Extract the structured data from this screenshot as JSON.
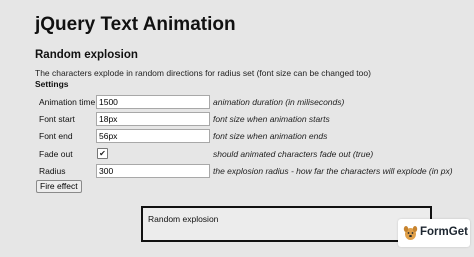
{
  "page": {
    "title": "jQuery Text Animation"
  },
  "section": {
    "title": "Random explosion",
    "description": "The characters explode in random directions for radius set (font size can be changed too)",
    "settings_heading": "Settings"
  },
  "settings": [
    {
      "label": "Animation time",
      "value": "1500",
      "hint": "animation duration (in miliseconds)"
    },
    {
      "label": "Font start",
      "value": "18px",
      "hint": "font size when animation starts"
    },
    {
      "label": "Font end",
      "value": "56px",
      "hint": "font size when animation ends"
    },
    {
      "label": "Fade out",
      "checked": true,
      "check_glyph": "✔",
      "hint": "should animated characters fade out (true)"
    },
    {
      "label": "Radius",
      "value": "300",
      "hint": "the explosion radius - how far the characters will explode (in px)"
    }
  ],
  "fire_button": {
    "label": "Fire effect"
  },
  "output": {
    "text": "Random explosion"
  },
  "badge": {
    "brand": "FormGet",
    "icon": "formget-dog-logo",
    "brand_color": "#1d2630",
    "icon_color": "#e0a04a"
  }
}
